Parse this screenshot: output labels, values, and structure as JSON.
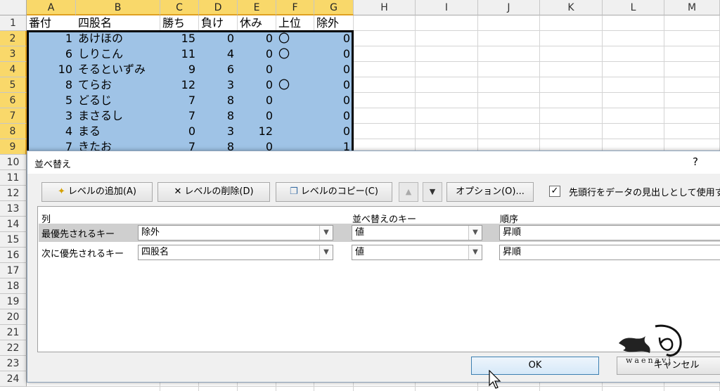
{
  "sheet": {
    "columns": [
      "A",
      "B",
      "C",
      "D",
      "E",
      "F",
      "G",
      "H",
      "I",
      "J",
      "K",
      "L",
      "M"
    ],
    "rows": [
      "1",
      "2",
      "3",
      "4",
      "5",
      "6",
      "7",
      "8",
      "9",
      "10",
      "11",
      "12",
      "13",
      "14",
      "15",
      "16",
      "17",
      "18",
      "19",
      "20",
      "21",
      "22",
      "23",
      "24"
    ],
    "headers": [
      "番付",
      "四股名",
      "勝ち",
      "負け",
      "休み",
      "上位",
      "除外"
    ],
    "data": [
      [
        "1",
        "あけほの",
        "15",
        "0",
        "0",
        "〇",
        "0"
      ],
      [
        "6",
        "しりこん",
        "11",
        "4",
        "0",
        "〇",
        "0"
      ],
      [
        "10",
        "そるといずみ",
        "9",
        "6",
        "0",
        "",
        "0"
      ],
      [
        "8",
        "てらお",
        "12",
        "3",
        "0",
        "〇",
        "0"
      ],
      [
        "5",
        "どるじ",
        "7",
        "8",
        "0",
        "",
        "0"
      ],
      [
        "3",
        "まさるし",
        "7",
        "8",
        "0",
        "",
        "0"
      ],
      [
        "4",
        "まる",
        "0",
        "3",
        "12",
        "",
        "0"
      ],
      [
        "7",
        "きたお",
        "7",
        "8",
        "0",
        "",
        "1"
      ]
    ]
  },
  "dialog": {
    "title": "並べ替え",
    "help": "?",
    "buttons": {
      "add_level": "レベルの追加(A)",
      "delete_level": "レベルの削除(D)",
      "copy_level": "レベルのコピー(C)",
      "move_up": "▲",
      "move_down": "▼",
      "options": "オプション(O)..."
    },
    "header_checkbox": {
      "checked": true,
      "label": "先頭行をデータの見出しとして使用する(H)"
    },
    "grid_headers": {
      "column": "列",
      "sort_on": "並べ替えのキー",
      "order": "順序"
    },
    "levels": [
      {
        "label": "最優先されるキー",
        "column": "除外",
        "sort_on": "値",
        "order": "昇順"
      },
      {
        "label": "次に優先されるキー",
        "column": "四股名",
        "sort_on": "値",
        "order": "昇順"
      }
    ],
    "ok": "OK",
    "cancel": "キャンセル"
  },
  "watermark": {
    "text": "waenavi"
  },
  "colors": {
    "selection": "#9fc3e6",
    "header_selected": "#f9d86a",
    "dialog_bg": "#f0f0f0"
  }
}
